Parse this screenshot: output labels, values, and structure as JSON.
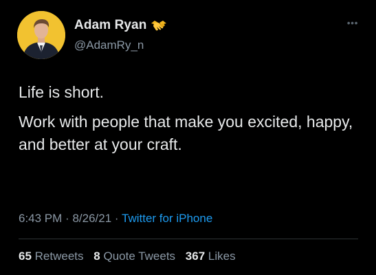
{
  "user": {
    "display_name": "Adam Ryan",
    "handle": "@AdamRy_n",
    "badge_icon": "handshake-icon",
    "avatar_bg": "#f2c230"
  },
  "more_icon": "more-options-icon",
  "tweet": {
    "paragraphs": [
      "Life is short.",
      "Work with people that make you excited, happy, and better at your craft."
    ]
  },
  "meta": {
    "time": "6:43 PM",
    "separator_1": "·",
    "date": "8/26/21",
    "separator_2": "·",
    "source": "Twitter for iPhone"
  },
  "stats": {
    "retweets_count": "65",
    "retweets_label": "Retweets",
    "quotes_count": "8",
    "quotes_label": "Quote Tweets",
    "likes_count": "367",
    "likes_label": "Likes"
  },
  "colors": {
    "background": "#000000",
    "text": "#e7e9ea",
    "secondary": "#8b98a5",
    "link": "#1d9bf0",
    "divider": "#2f3336"
  }
}
